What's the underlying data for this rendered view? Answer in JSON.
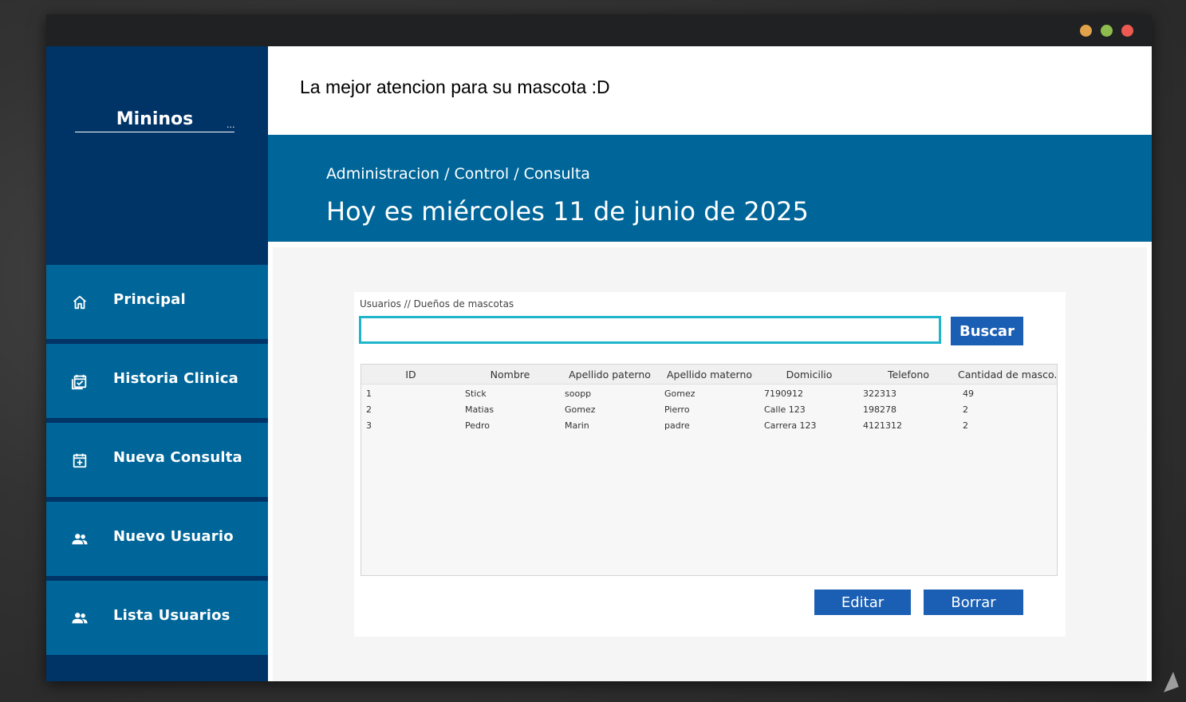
{
  "window": {
    "controls": [
      "minimize",
      "maximize",
      "close"
    ]
  },
  "sidebar": {
    "brand": "Mininos",
    "brand_ellipsis": "...",
    "items": [
      {
        "label": "Principal",
        "icon": "home-icon"
      },
      {
        "label": "Historia Clinica",
        "icon": "calendar-check-icon"
      },
      {
        "label": "Nueva Consulta",
        "icon": "calendar-plus-icon"
      },
      {
        "label": "Nuevo Usuario",
        "icon": "users-icon"
      },
      {
        "label": "Lista Usuarios",
        "icon": "users-icon"
      }
    ]
  },
  "topbar": {
    "slogan": "La mejor atencion para su mascota :D"
  },
  "header": {
    "breadcrumb": "Administracion / Control / Consulta",
    "date": "Hoy es miércoles 11 de junio de 2025"
  },
  "search": {
    "label": "Usuarios // Dueños de mascotas",
    "value": "",
    "button": "Buscar"
  },
  "table": {
    "columns": [
      "ID",
      "Nombre",
      "Apellido paterno",
      "Apellido materno",
      "Domicilio",
      "Telefono",
      "Cantidad de masco..."
    ],
    "rows": [
      [
        "1",
        "Stick",
        "soopp",
        "Gomez",
        "7190912",
        "322313",
        "49"
      ],
      [
        "2",
        "Matias",
        "Gomez",
        "Pierro",
        "Calle 123",
        "198278",
        "2"
      ],
      [
        "3",
        "Pedro",
        "Marin",
        "padre",
        "Carrera 123",
        "4121312",
        "2"
      ]
    ]
  },
  "actions": {
    "edit": "Editar",
    "delete": "Borrar"
  },
  "colors": {
    "sidebar_dark": "#003366",
    "nav_item": "#006699",
    "header": "#006699",
    "button": "#1a5fb4",
    "input_border": "#1fb6cc"
  }
}
